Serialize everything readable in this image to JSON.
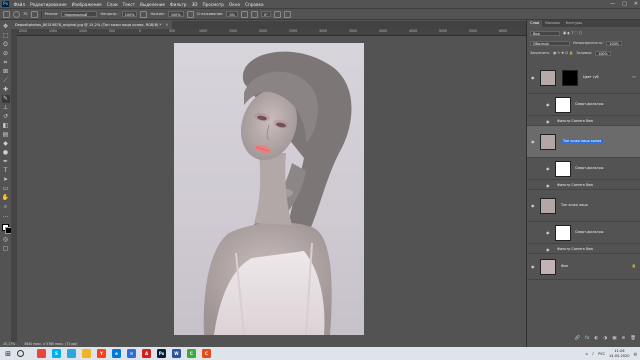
{
  "menubar": {
    "logo": "Ps",
    "items": [
      "Файл",
      "Редактирование",
      "Изображение",
      "Слои",
      "Текст",
      "Выделение",
      "Фильтр",
      "3D",
      "Просмотр",
      "Окно",
      "Справка"
    ],
    "window_controls": [
      "—",
      "□",
      "✕"
    ]
  },
  "options": {
    "brush_size": "70",
    "mode_label": "Режим:",
    "mode_value": "Нормальный",
    "opacity_label": "Непрозр.:",
    "opacity_value": "100%",
    "flow_label": "Нажим:",
    "flow_value": "100%",
    "smoothing_label": "Сглаживание:",
    "smoothing_value": "0%",
    "angle_value": "0°"
  },
  "document": {
    "tab_title": "Depositphotos_80319878_original.jpg @ 15,2% (Тон кожи лица копия, RGB/8) *",
    "close_glyph": "✕"
  },
  "ruler": {
    "ticks": [
      "2000",
      "1500",
      "1000",
      "500",
      "0",
      "500",
      "1000",
      "1500",
      "2000",
      "2500",
      "3000",
      "3500",
      "4000",
      "4500",
      "5000",
      "5500",
      "6000"
    ]
  },
  "statusbar": {
    "zoom": "15,17%",
    "doc_info": "3840 пикс. x 5760 пикс. (72 ppi)"
  },
  "panel": {
    "tabs": [
      "Слои",
      "Каналы",
      "Контуры"
    ],
    "search_label": "Вид",
    "blend_mode": "Обычные",
    "opacity_label": "Непрозрачность:",
    "opacity_value": "100%",
    "lock_label": "Закрепить:",
    "fill_label": "Заливка:",
    "fill_value": "100%",
    "footer_icons": [
      "🔗",
      "fx",
      "◐",
      "◑",
      "▣",
      "⊕",
      "🗑"
    ]
  },
  "layers": [
    {
      "name": "Цвет губ",
      "kind": "group-mask",
      "selected": false
    },
    {
      "name": "Смарт-фильтры",
      "kind": "filter-mask",
      "selected": false
    },
    {
      "name": "Фильтр Camera Raw",
      "kind": "filter",
      "selected": false
    },
    {
      "name": "Тон кожи лица копия",
      "kind": "smart",
      "selected": true
    },
    {
      "name": "Смарт-фильтры",
      "kind": "filter-mask",
      "selected": false
    },
    {
      "name": "Фильтр Camera Raw",
      "kind": "filter",
      "selected": false
    },
    {
      "name": "Тон кожи лица",
      "kind": "smart",
      "selected": false
    },
    {
      "name": "Смарт-фильтры",
      "kind": "filter-mask",
      "selected": false
    },
    {
      "name": "Фильтр Camera Raw",
      "kind": "filter",
      "selected": false
    },
    {
      "name": "Фон",
      "kind": "background",
      "selected": false
    }
  ],
  "taskbar": {
    "apps": [
      {
        "icon": "chrome-icon",
        "label": "",
        "color": "#e8453c"
      },
      {
        "icon": "skype-icon",
        "label": "S",
        "color": "#00aff0"
      },
      {
        "icon": "telegram-icon",
        "label": "",
        "color": "#2ca5e0"
      },
      {
        "icon": "folder-icon",
        "label": "",
        "color": "#f0b429"
      },
      {
        "icon": "yandex-icon",
        "label": "Y",
        "color": "#fc3f1d"
      },
      {
        "icon": "edge-icon",
        "label": "e",
        "color": "#0078d7"
      },
      {
        "icon": "mail-icon",
        "label": "✉",
        "color": "#2c6ed5"
      },
      {
        "icon": "acrobat-icon",
        "label": "A",
        "color": "#d4201e"
      },
      {
        "icon": "photoshop-icon",
        "label": "Ps",
        "color": "#001e36"
      },
      {
        "icon": "word-icon",
        "label": "W",
        "color": "#2b579a"
      },
      {
        "icon": "camtasia-icon",
        "label": "C",
        "color": "#3da93d"
      },
      {
        "icon": "screenrec-icon",
        "label": "C",
        "color": "#e64a19"
      }
    ],
    "tray_lang": "РУС",
    "time": "11:26",
    "date": "14.05.2020"
  }
}
